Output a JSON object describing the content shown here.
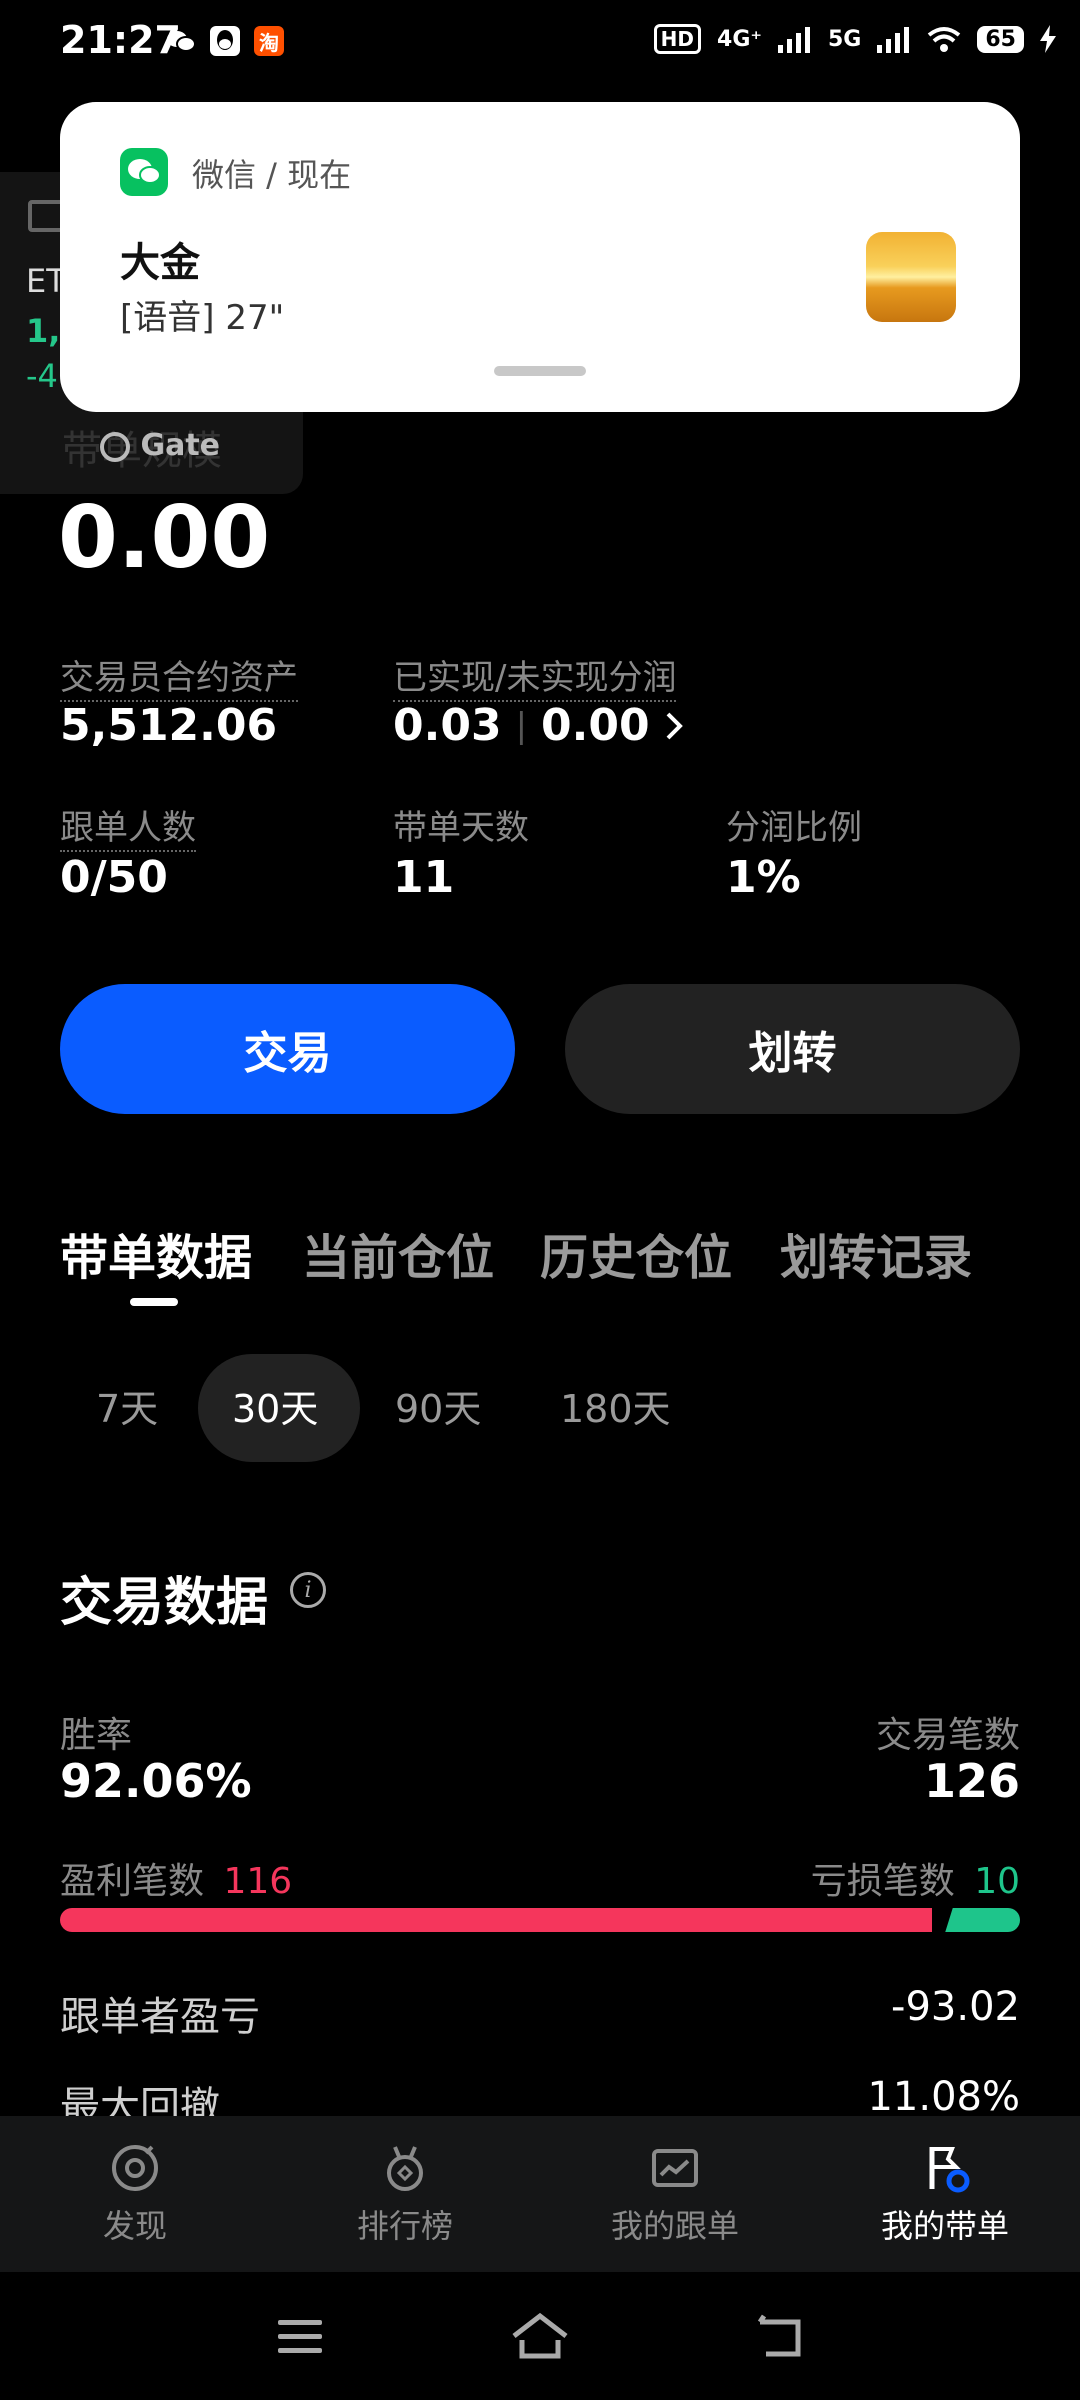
{
  "status_bar": {
    "time": "21:27",
    "hd_badge": "HD",
    "network_1": "4G⁺",
    "network_2": "5G",
    "battery": "65",
    "icons": [
      "wechat-icon",
      "qq-icon",
      "taobao-icon",
      "wifi-icon",
      "charging-icon"
    ]
  },
  "floating_widget": {
    "label_1": "ET",
    "value_1": "1,",
    "value_2": "-4",
    "brand": "Gate"
  },
  "notification": {
    "app_name": "微信 / 现在",
    "title": "大金",
    "body": "[语音] 27\""
  },
  "header": {
    "section_label": "带单规模",
    "big_value": "0.00"
  },
  "stats": {
    "assets_label": "交易员合约资产",
    "assets_value": "5,512.06",
    "profit_share_label": "已实现/未实现分润",
    "realized": "0.03",
    "separator": "|",
    "unrealized": "0.00",
    "followers_label": "跟单人数",
    "followers_value": "0/50",
    "days_label": "带单天数",
    "days_value": "11",
    "share_ratio_label": "分润比例",
    "share_ratio_value": "1%"
  },
  "buttons": {
    "trade": "交易",
    "transfer": "划转"
  },
  "tabs": [
    "带单数据",
    "当前仓位",
    "历史仓位",
    "划转记录"
  ],
  "ranges": [
    "7天",
    "30天",
    "90天",
    "180天"
  ],
  "selected_range": "30天",
  "trade_data": {
    "title": "交易数据",
    "win_rate_label": "胜率",
    "win_rate_value": "92.06%",
    "trade_count_label": "交易笔数",
    "trade_count_value": "126",
    "profit_count_label": "盈利笔数",
    "profit_count_value": "116",
    "loss_count_label": "亏损笔数",
    "loss_count_value": "10",
    "profit_fraction": 0.9206,
    "follower_pnl_label": "跟单者盈亏",
    "follower_pnl_value": "-93.02",
    "max_drawdown_label": "最大回撤",
    "max_drawdown_value": "11.08%"
  },
  "colors": {
    "primary_blue": "#0a5cff",
    "profit_red": "#f5365c",
    "loss_green": "#1ec58b"
  },
  "bottom_nav": [
    {
      "label": "发现",
      "icon": "discover-icon"
    },
    {
      "label": "排行榜",
      "icon": "medal-icon"
    },
    {
      "label": "我的跟单",
      "icon": "chart-card-icon"
    },
    {
      "label": "我的带单",
      "icon": "flag-icon",
      "active": true
    }
  ]
}
